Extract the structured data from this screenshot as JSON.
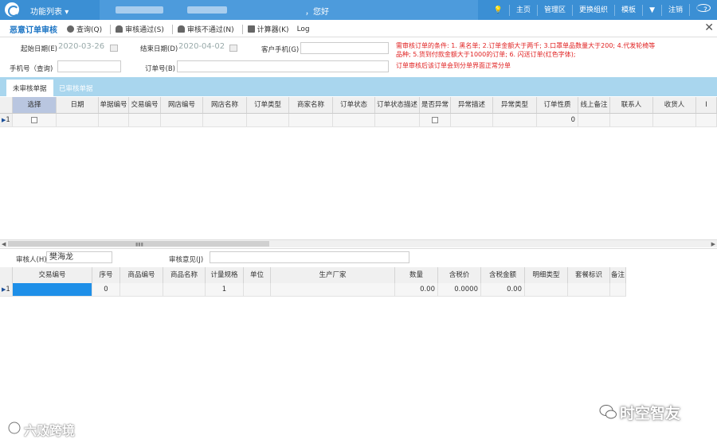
{
  "topnav": {
    "menu_label": "功能列表",
    "greeting": "，您好",
    "links": [
      "主页",
      "管理区",
      "更换组织",
      "模板",
      "注销"
    ]
  },
  "toolbar": {
    "title": "恶意订单审核",
    "buttons": [
      {
        "icon": "query-icon",
        "label": "查询(Q)"
      },
      {
        "icon": "approve-icon",
        "label": "审核通过(S)"
      },
      {
        "icon": "reject-icon",
        "label": "审核不通过(N)"
      },
      {
        "icon": "calculator-icon",
        "label": "计算器(K)"
      },
      {
        "icon": "",
        "label": "Log"
      }
    ]
  },
  "filters": {
    "start_date_label": "起始日期(E)",
    "start_date_value": "2020-03-26",
    "end_date_label": "结束日期(D)",
    "end_date_value": "2020-04-02",
    "customer_phone_label": "客户手机(G)",
    "phone_query_label": "手机号（查询)",
    "order_no_label": "订单号(B)"
  },
  "notice": {
    "line1": "需审核订单的条件: 1. 黑名单; 2.订单金额大于两千; 3.口罩单品数量大于200; 4.代发轮椅等",
    "line2": "品种;  5.货到付款金额大于1000的订单; 6. 闪送订单(红色字体);",
    "line3": "订单审核后该订单会到分单界面正常分单"
  },
  "tabs": {
    "pending": "未审核单据",
    "reviewed": "已审核单据"
  },
  "main_grid": {
    "columns": [
      "选择",
      "日期",
      "单据编号",
      "交易编号",
      "网店编号",
      "网店名称",
      "订单类型",
      "商家名称",
      "订单状态",
      "订单状态描述",
      "是否异常",
      "异常描述",
      "异常类型",
      "订单性质",
      "线上备注",
      "联系人",
      "收货人",
      "I"
    ],
    "row": {
      "index": "1",
      "order_nature": "0"
    }
  },
  "review": {
    "reviewer_label": "审核人(H)",
    "reviewer_value": "樊海龙",
    "opinion_label": "审核意见(J)"
  },
  "detail_grid": {
    "columns": [
      "交易编号",
      "序号",
      "商品编号",
      "商品名称",
      "计量规格",
      "单位",
      "生产厂家",
      "数量",
      "含税价",
      "含税金额",
      "明细类型",
      "套餐标识",
      "备注"
    ],
    "row": {
      "index": "1",
      "seq": "0",
      "spec": "1",
      "qty": "0.00",
      "price": "0.0000",
      "amount": "0.00"
    }
  },
  "watermarks": {
    "left": "六败跨境",
    "right": "时空智友"
  }
}
